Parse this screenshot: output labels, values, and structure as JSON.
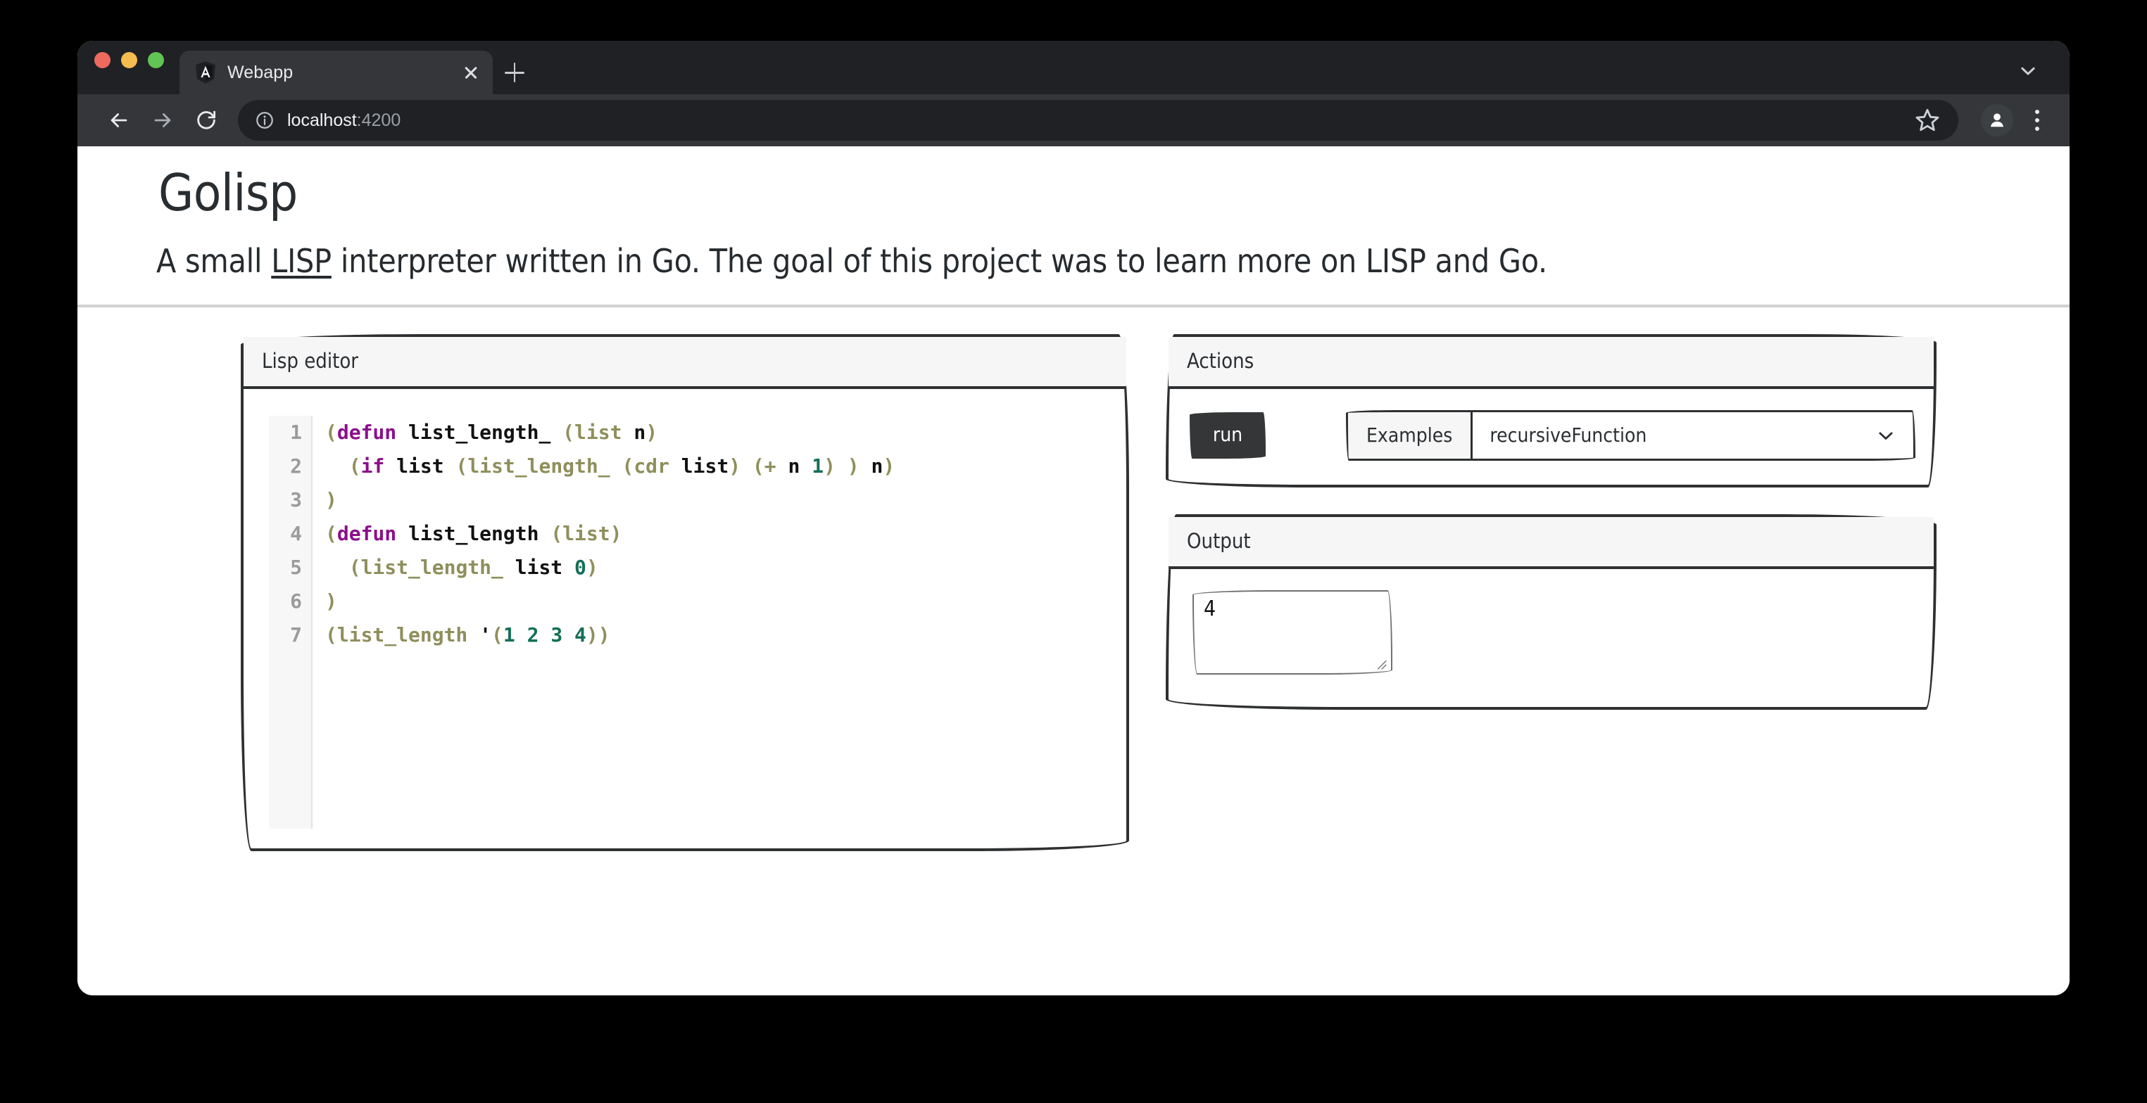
{
  "browser": {
    "traffic_lights": [
      "close",
      "minimize",
      "maximize"
    ],
    "tab": {
      "title": "Webapp",
      "favicon": "angular-icon",
      "close_icon": "close-icon"
    },
    "new_tab_icon": "plus-icon",
    "tab_list_icon": "chevron-down-icon",
    "toolbar": {
      "back_icon": "arrow-left-icon",
      "forward_icon": "arrow-right-icon",
      "reload_icon": "reload-icon",
      "site_info_icon": "info-icon",
      "url_host": "localhost",
      "url_port": ":4200",
      "url_full": "localhost:4200",
      "bookmark_icon": "star-icon",
      "profile_icon": "account-icon",
      "menu_icon": "three-dots-icon"
    }
  },
  "page": {
    "title": "Golisp",
    "subtitle_prefix": "A small ",
    "subtitle_link": "LISP",
    "subtitle_suffix": " interpreter written in Go. The goal of this project was to learn more on LISP and Go."
  },
  "editor": {
    "header": "Lisp editor",
    "line_numbers": [
      "1",
      "2",
      "3",
      "4",
      "5",
      "6",
      "7"
    ],
    "lines": [
      "(defun list_length_ (list n)",
      "  (if list (list_length_ (cdr list) (+ n 1) ) n)",
      ")",
      "(defun list_length (list)",
      "  (list_length_ list 0)",
      ")",
      "(list_length '(1 2 3 4))"
    ]
  },
  "actions": {
    "header": "Actions",
    "run_label": "run",
    "examples_label": "Examples",
    "selected_example": "recursiveFunction",
    "chevron_icon": "chevron-down-icon"
  },
  "output": {
    "header": "Output",
    "value": "4",
    "resize_icon": "resize-grip-icon"
  },
  "colors": {
    "browser_chrome": "#35363a",
    "tab_strip": "#202124",
    "accent_dark": "#343637",
    "paren": "#8f8f5c",
    "keyword": "#8b0f8b",
    "number": "#127054"
  }
}
